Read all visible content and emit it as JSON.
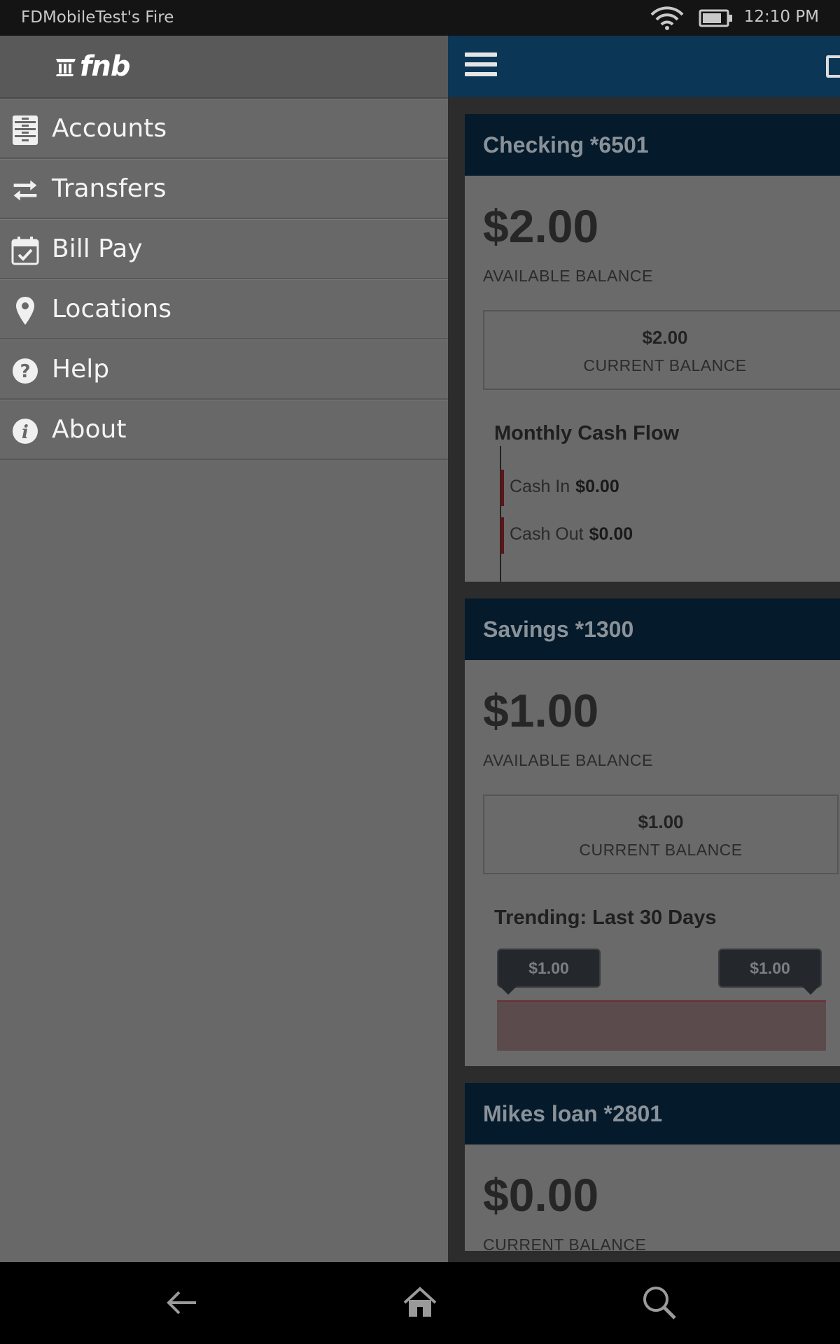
{
  "status_bar": {
    "device_name": "FDMobileTest's Fire",
    "time": "12:10 PM"
  },
  "drawer": {
    "logo_text": "fnb",
    "items": [
      {
        "label": "Accounts",
        "icon": "accounts-icon"
      },
      {
        "label": "Transfers",
        "icon": "transfers-icon"
      },
      {
        "label": "Bill Pay",
        "icon": "calendar-check-icon"
      },
      {
        "label": "Locations",
        "icon": "map-pin-icon"
      },
      {
        "label": "Help",
        "icon": "question-icon"
      },
      {
        "label": "About",
        "icon": "info-icon"
      }
    ]
  },
  "accounts": [
    {
      "title": "Checking *6501",
      "available_amount": "$2.00",
      "available_label": "AVAILABLE BALANCE",
      "current_amount": "$2.00",
      "current_label": "CURRENT BALANCE",
      "section_title": "Monthly Cash Flow",
      "cash_in_label": "Cash In",
      "cash_in_value": "$0.00",
      "cash_out_label": "Cash Out",
      "cash_out_value": "$0.00"
    },
    {
      "title": "Savings *1300",
      "available_amount": "$1.00",
      "available_label": "AVAILABLE BALANCE",
      "current_amount": "$1.00",
      "current_label": "CURRENT BALANCE",
      "section_title": "Trending: Last 30 Days",
      "trend_start": "$1.00",
      "trend_end": "$1.00"
    },
    {
      "title": "Mikes loan *2801",
      "current_amount": "$0.00",
      "current_label": "CURRENT BALANCE"
    }
  ],
  "colors": {
    "app_bar": "#0b3656",
    "drawer": "#686868",
    "card_header": "#051a2b"
  }
}
